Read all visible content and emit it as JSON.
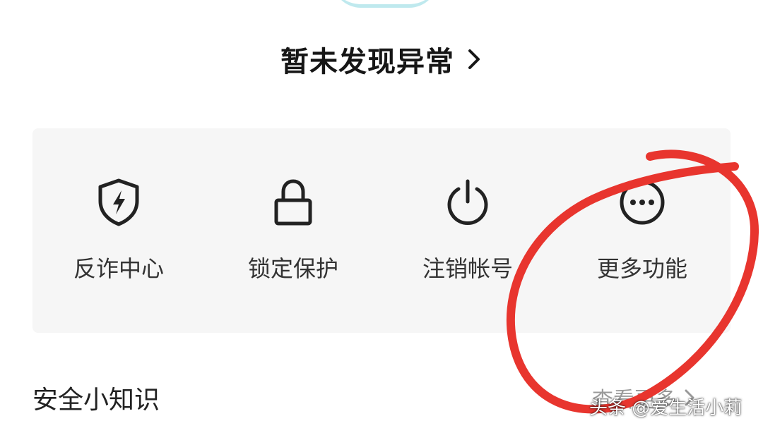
{
  "status": {
    "text": "暂未发现异常"
  },
  "tools": [
    {
      "label": "反诈中心",
      "icon": "shield-lightning-icon"
    },
    {
      "label": "锁定保护",
      "icon": "lock-icon"
    },
    {
      "label": "注销帐号",
      "icon": "power-icon"
    },
    {
      "label": "更多功能",
      "icon": "more-dots-icon"
    }
  ],
  "section": {
    "title": "安全小知识",
    "more_label": "查看更多"
  },
  "watermark": {
    "text": "头条 @爱生活小莉"
  },
  "colors": {
    "annotation": "#e8352e",
    "panel": "#f6f6f6",
    "top_arc": "#bfe9ee"
  }
}
